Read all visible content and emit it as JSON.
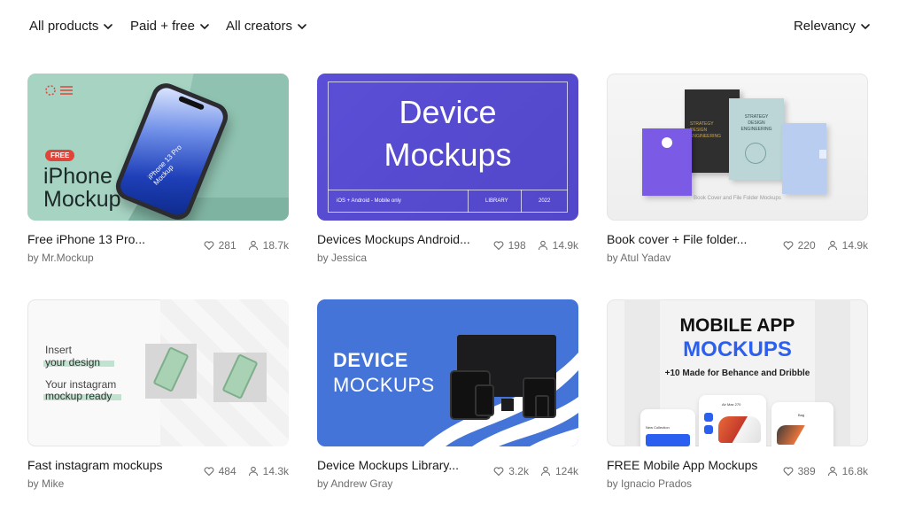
{
  "filters": {
    "products": "All products",
    "pricing": "Paid + free",
    "creators": "All creators",
    "sort": "Relevancy"
  },
  "cards": [
    {
      "title": "Free iPhone 13 Pro...",
      "author": "by Mr.Mockup",
      "likes": "281",
      "views": "18.7k",
      "thumb": {
        "badge": "FREE",
        "headline_1": "iPhone",
        "headline_2": "Mockup",
        "screen_text": "iPhone 13 Pro\nMockup"
      }
    },
    {
      "title": "Devices Mockups Android...",
      "author": "by Jessica",
      "likes": "198",
      "views": "14.9k",
      "thumb": {
        "headline_1": "Device",
        "headline_2": "Mockups",
        "footer_left": "iOS + Android - Mobile only",
        "footer_mid": "LIBRARY",
        "footer_right": "2022"
      }
    },
    {
      "title": "Book cover + File folder...",
      "author": "by Atul Yadav",
      "likes": "220",
      "views": "14.9k",
      "thumb": {
        "caption": "Book Cover and File Folder Mockups",
        "book_text_1": "STRATEGY DESIGN ENGINEERING",
        "book_text_2": "STRATEGY DESIGN ENGINEERING"
      }
    },
    {
      "title": "Fast instagram mockups",
      "author": "by Mike",
      "likes": "484",
      "views": "14.3k",
      "thumb": {
        "line_1": "Insert",
        "line_2": "your design",
        "line_3": "Your instagram",
        "line_4": "mockup ready"
      }
    },
    {
      "title": "Device Mockups Library...",
      "author": "by Andrew Gray",
      "likes": "3.2k",
      "views": "124k",
      "thumb": {
        "headline_1": "DEVICE",
        "headline_2": "MOCKUPS"
      }
    },
    {
      "title": "FREE Mobile App Mockups",
      "author": "by Ignacio Prados",
      "likes": "389",
      "views": "16.8k",
      "thumb": {
        "headline_1": "MOBILE APP",
        "headline_2": "MOCKUPS",
        "subline": "+10 Made for Behance and Dribble",
        "screen_1": "New Collection",
        "screen_2": "Air Max 270",
        "screen_3": "Bag"
      }
    }
  ],
  "colors": {
    "accent_purple": "#5a4fd6",
    "mint": "#a6d3c2",
    "blue": "#4474d8",
    "app_blue": "#2a5ff0",
    "muted_text": "#6e6e6e"
  },
  "icons": [
    "chevron-down-icon",
    "heart-icon",
    "user-icon"
  ]
}
